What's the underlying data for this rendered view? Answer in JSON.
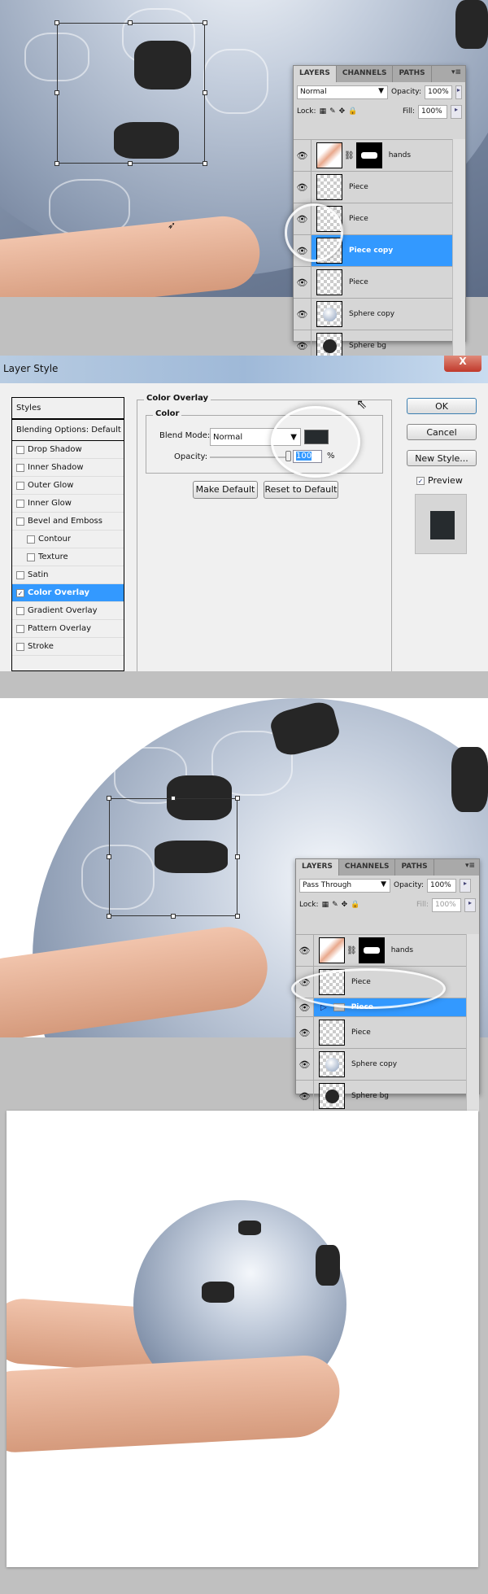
{
  "panel1": {
    "tabs": [
      "LAYERS",
      "CHANNELS",
      "PATHS"
    ],
    "blend_mode": "Normal",
    "opacity_label": "Opacity:",
    "opacity": "100%",
    "lock_label": "Lock:",
    "fill_label": "Fill:",
    "fill": "100%",
    "layers": [
      {
        "name": "hands"
      },
      {
        "name": "Piece"
      },
      {
        "name": "Piece"
      },
      {
        "name": "Piece copy",
        "selected": true
      },
      {
        "name": "Piece"
      },
      {
        "name": "Sphere copy"
      },
      {
        "name": "Sphere bg"
      }
    ]
  },
  "dialog": {
    "title": "Layer Style",
    "close": "X",
    "styles_header": "Styles",
    "blending": "Blending Options: Default",
    "items": [
      {
        "label": "Drop Shadow",
        "checked": false
      },
      {
        "label": "Inner Shadow",
        "checked": false
      },
      {
        "label": "Outer Glow",
        "checked": false
      },
      {
        "label": "Inner Glow",
        "checked": false
      },
      {
        "label": "Bevel and Emboss",
        "checked": false
      },
      {
        "label": "Contour",
        "checked": false,
        "sub": true
      },
      {
        "label": "Texture",
        "checked": false,
        "sub": true
      },
      {
        "label": "Satin",
        "checked": false
      },
      {
        "label": "Color Overlay",
        "checked": true,
        "selected": true
      },
      {
        "label": "Gradient Overlay",
        "checked": false
      },
      {
        "label": "Pattern Overlay",
        "checked": false
      },
      {
        "label": "Stroke",
        "checked": false
      }
    ],
    "section_title": "Color Overlay",
    "group_title": "Color",
    "blend_label": "Blend Mode:",
    "blend_value": "Normal",
    "overlay_color": "#262b2e",
    "opacity_label": "Opacity:",
    "opacity_value": "100",
    "percent": "%",
    "make_default": "Make Default",
    "reset_default": "Reset to Default",
    "ok": "OK",
    "cancel": "Cancel",
    "new_style": "New Style...",
    "preview_label": "Preview",
    "preview_checked": true
  },
  "panel2": {
    "tabs": [
      "LAYERS",
      "CHANNELS",
      "PATHS"
    ],
    "blend_mode": "Pass Through",
    "opacity_label": "Opacity:",
    "opacity": "100%",
    "lock_label": "Lock:",
    "fill_label": "Fill:",
    "fill": "100%",
    "layers": [
      {
        "name": "hands"
      },
      {
        "name": "Piece"
      },
      {
        "name": "Piece",
        "group": true,
        "selected": true
      },
      {
        "name": "Piece"
      },
      {
        "name": "Sphere copy"
      },
      {
        "name": "Sphere bg"
      }
    ]
  },
  "colors": {
    "selection": "#3399ff",
    "piece": "#262626"
  }
}
